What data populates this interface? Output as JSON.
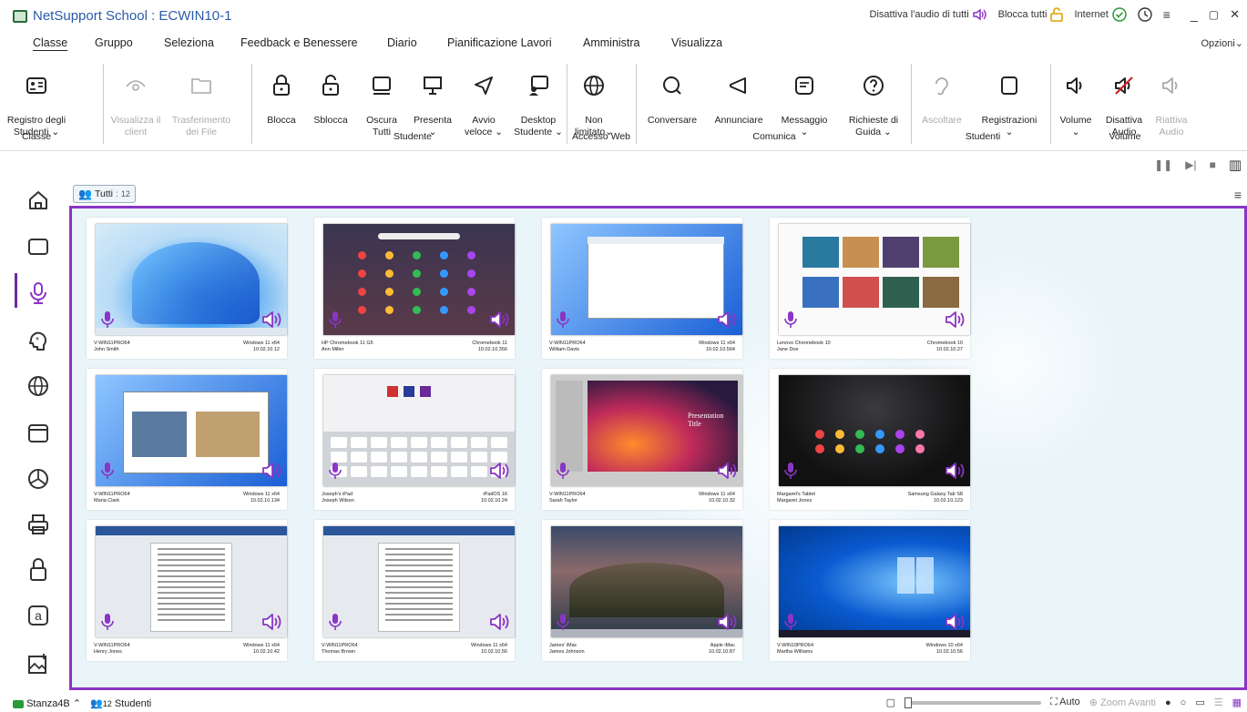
{
  "window": {
    "title": "NetSupport School : ECWIN10-1"
  },
  "title_controls": {
    "mute_all": "Disattiva l'audio di tutti",
    "lock_all": "Blocca tutti",
    "internet": "Internet"
  },
  "menu": {
    "items": [
      "Classe",
      "Gruppo",
      "Seleziona",
      "Feedback e Benessere",
      "Diario",
      "Pianificazione Lavori",
      "Amministra",
      "Visualizza"
    ],
    "active": "Classe",
    "options": "Opzioni"
  },
  "ribbon": {
    "register": "Registro degli\nStudenti ⌄",
    "view_client": "Visualizza il\nclient",
    "file_transfer": "Trasferimento\ndei File",
    "lock": "Blocca",
    "unlock": "Sblocca",
    "blank_all": "Oscura\nTutti",
    "show": "Presenta\n⌄",
    "quick_launch": "Avvio\nveloce ⌄",
    "student_desktop": "Desktop\nStudente ⌄",
    "unlimited": "Non\nlimitato⌄",
    "chat": "Conversare",
    "announce": "Annunciare",
    "message": "Messaggio\n⌄",
    "help_requests": "Richieste di\nGuida ⌄",
    "listen": "Ascoltare",
    "recordings": "Registrazioni\n⌄",
    "volume": "Volume\n⌄",
    "mute_audio": "Disattiva\nAudio",
    "unmute_audio": "Riattiva\nAudio",
    "groups": {
      "class": "Classe",
      "student": "Studente",
      "web": "Accesso Web",
      "communicate": "Comunica",
      "students": "Studenti",
      "volume": "Volume"
    }
  },
  "tab": {
    "label": "Tutti",
    "count": "12"
  },
  "tiles": [
    {
      "host": "V-WIN11PRO64",
      "user": "John Smith",
      "os": "Windows 11 x64",
      "ip": "10.02.10.12",
      "screen": "win11-bloom"
    },
    {
      "host": "HP Chromebook 11 G5",
      "user": "Ann Miller",
      "os": "Chromebook 11",
      "ip": "10.02.10.356",
      "screen": "chrome-launcher"
    },
    {
      "host": "V-WIN11PRO64",
      "user": "William Davis",
      "os": "Windows 11 x64",
      "ip": "10.02.10.564",
      "screen": "win11-explorer"
    },
    {
      "host": "Lenovo Chromebook 10",
      "user": "Jane Doe",
      "os": "Chromebook 10",
      "ip": "10.02.10.27",
      "screen": "youtube"
    },
    {
      "host": "V-WIN11PRO64",
      "user": "Maria Clark",
      "os": "Windows 11 x64",
      "ip": "10.02.10.134",
      "screen": "win11-browser"
    },
    {
      "host": "Joseph's iPad",
      "user": "Joseph Wilson",
      "os": "iPadOS 16",
      "ip": "10.02.10.24",
      "screen": "ipad-keyboard"
    },
    {
      "host": "V-WIN11PRO64",
      "user": "Sarah Taylor",
      "os": "Windows 11 x64",
      "ip": "10.02.10.32",
      "screen": "presentation"
    },
    {
      "host": "Margaret's Tablet",
      "user": "Margaret Jones",
      "os": "Samsung Galaxy Tab S8",
      "ip": "10.02.10.123",
      "screen": "android"
    },
    {
      "host": "V-WIN11PRO64",
      "user": "Henry Jones",
      "os": "Windows 11 x64",
      "ip": "10.02.10.42",
      "screen": "word-doc"
    },
    {
      "host": "V-WIN11PRO64",
      "user": "Thomas Brown",
      "os": "Windows 11 x64",
      "ip": "10.02.10.56",
      "screen": "word-doc2"
    },
    {
      "host": "James' iMac",
      "user": "James Johnson",
      "os": "Apple iMac",
      "ip": "10.02.10.87",
      "screen": "macos"
    },
    {
      "host": "V-WIN10PRO64",
      "user": "Martha Williams",
      "os": "Windows 10 x64",
      "ip": "10.02.10.56",
      "screen": "win10"
    }
  ],
  "presentation_text": {
    "title": "Presentation\nTitle"
  },
  "status": {
    "room": "Stanza4B",
    "students_count": "12",
    "students_label": "Studenti",
    "auto": "Auto",
    "zoom_in": "Zoom Avanti"
  }
}
